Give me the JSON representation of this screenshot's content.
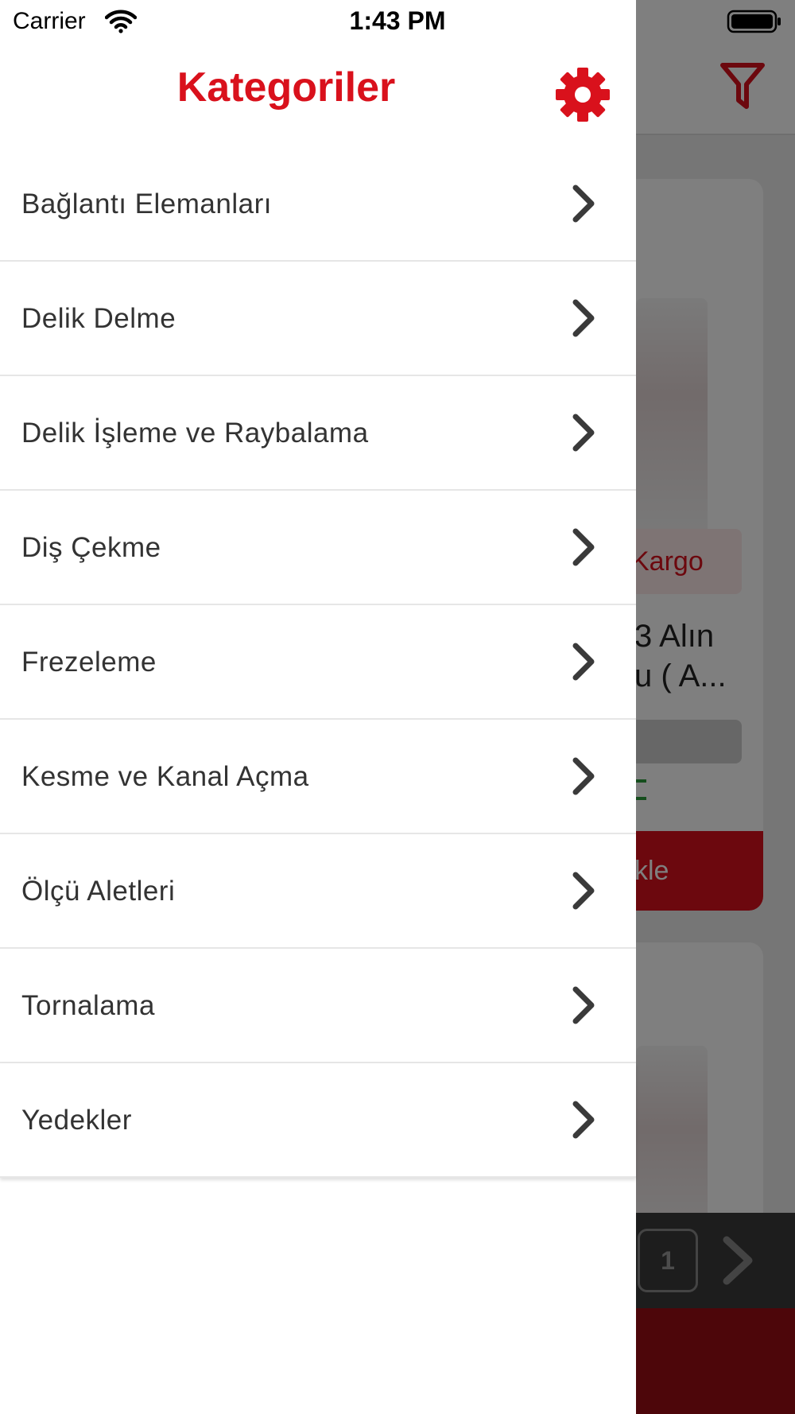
{
  "status_bar": {
    "carrier": "Carrier",
    "time": "1:43 PM",
    "wifi_icon": "wifi-icon",
    "battery_icon": "battery-icon"
  },
  "drawer": {
    "title": "Kategoriler",
    "settings_icon": "gear-icon",
    "accent_color": "#d9111c",
    "categories": [
      {
        "label": "Bağlantı Elemanları"
      },
      {
        "label": "Delik Delme"
      },
      {
        "label": "Delik İşleme ve Raybalama"
      },
      {
        "label": "Diş Çekme"
      },
      {
        "label": "Frezeleme"
      },
      {
        "label": "Kesme ve Kanal Açma"
      },
      {
        "label": "Ölçü Aletleri"
      },
      {
        "label": "Tornalama"
      },
      {
        "label": "Yedekler"
      }
    ]
  },
  "background": {
    "filter_icon": "filter-icon",
    "badge_partial": "Kargo",
    "title_partial_line1": "3 Alın",
    "title_partial_line2": "u ( A...",
    "add_button_partial": "kle",
    "current_page": "1",
    "next_icon": "chevron-right-icon"
  }
}
